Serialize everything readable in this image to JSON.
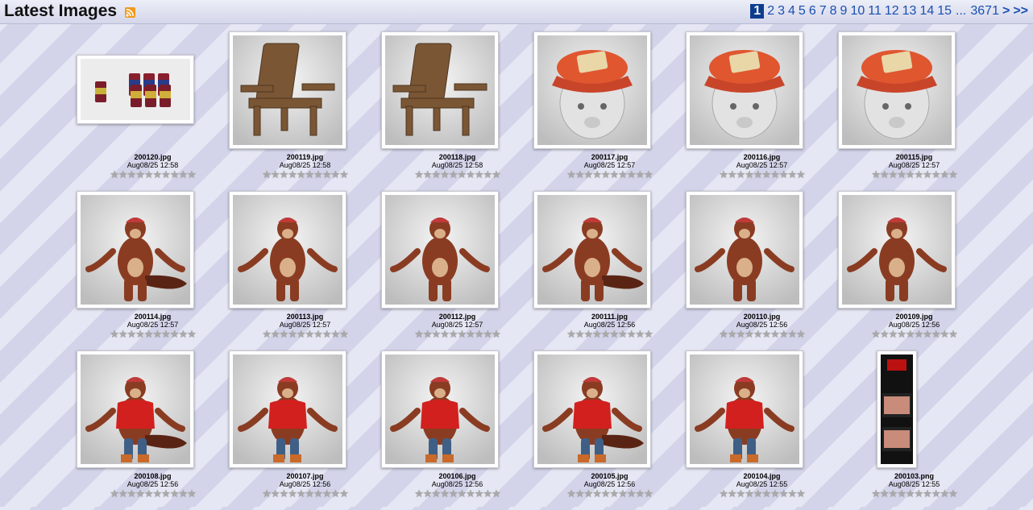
{
  "header": {
    "title": "Latest Images",
    "rss_icon": "rss-feed-icon"
  },
  "pagination": {
    "current": "1",
    "pages": [
      "2",
      "3",
      "4",
      "5",
      "6",
      "7",
      "8",
      "9",
      "10",
      "11",
      "12",
      "13",
      "14",
      "15"
    ],
    "ellipsis": "...",
    "last": "3671",
    "next": ">",
    "last_nav": ">>"
  },
  "rating_scale": 10,
  "images": [
    {
      "file": "200120.jpg",
      "date": "Aug08/25 12:58",
      "subject": "beer-cans"
    },
    {
      "file": "200119.jpg",
      "date": "Aug08/25 12:58",
      "subject": "chair"
    },
    {
      "file": "200118.jpg",
      "date": "Aug08/25 12:58",
      "subject": "chair"
    },
    {
      "file": "200117.jpg",
      "date": "Aug08/25 12:57",
      "subject": "cap-head-side"
    },
    {
      "file": "200116.jpg",
      "date": "Aug08/25 12:57",
      "subject": "cap-head-front"
    },
    {
      "file": "200115.jpg",
      "date": "Aug08/25 12:57",
      "subject": "cap-head-front"
    },
    {
      "file": "200114.jpg",
      "date": "Aug08/25 12:57",
      "subject": "figure-back"
    },
    {
      "file": "200113.jpg",
      "date": "Aug08/25 12:57",
      "subject": "figure-front"
    },
    {
      "file": "200112.jpg",
      "date": "Aug08/25 12:57",
      "subject": "figure-front"
    },
    {
      "file": "200111.jpg",
      "date": "Aug08/25 12:56",
      "subject": "figure-back"
    },
    {
      "file": "200110.jpg",
      "date": "Aug08/25 12:56",
      "subject": "figure-front"
    },
    {
      "file": "200109.jpg",
      "date": "Aug08/25 12:56",
      "subject": "figure-front"
    },
    {
      "file": "200108.jpg",
      "date": "Aug08/25 12:56",
      "subject": "clothed-back"
    },
    {
      "file": "200107.jpg",
      "date": "Aug08/25 12:56",
      "subject": "clothed-front"
    },
    {
      "file": "200106.jpg",
      "date": "Aug08/25 12:56",
      "subject": "clothed-front"
    },
    {
      "file": "200105.jpg",
      "date": "Aug08/25 12:56",
      "subject": "clothed-back"
    },
    {
      "file": "200104.jpg",
      "date": "Aug08/25 12:55",
      "subject": "clothed-front"
    },
    {
      "file": "200103.png",
      "date": "Aug08/25 12:55",
      "subject": "web-screenshot"
    }
  ]
}
